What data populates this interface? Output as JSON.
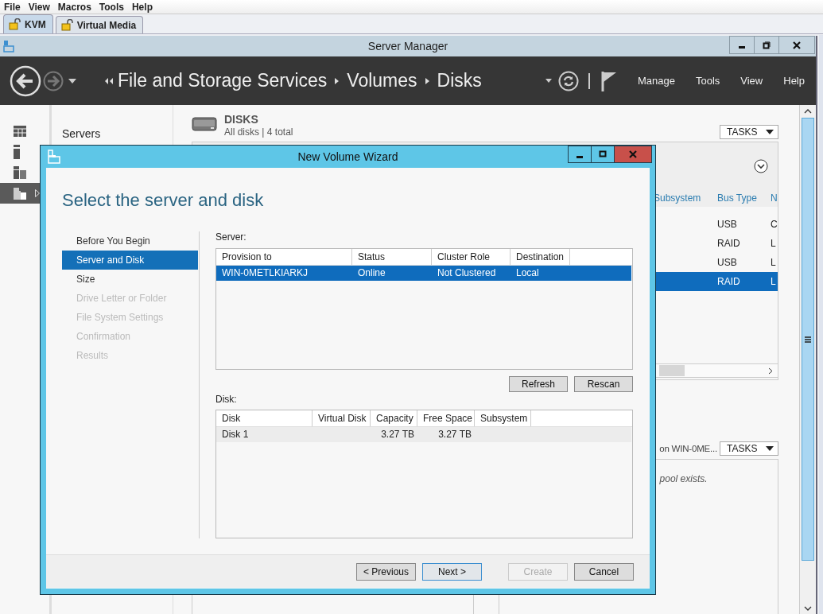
{
  "kvm_menu": [
    "File",
    "View",
    "Macros",
    "Tools",
    "Help"
  ],
  "kvm_tabs": [
    {
      "label": "KVM",
      "selected": true
    },
    {
      "label": "Virtual Media",
      "selected": false
    }
  ],
  "window": {
    "title": "Server Manager"
  },
  "header": {
    "breadcrumb": [
      "File and Storage Services",
      "Volumes",
      "Disks"
    ],
    "menu": [
      "Manage",
      "Tools",
      "View",
      "Help"
    ]
  },
  "sidebar": {
    "items": [
      {
        "selected": false
      },
      {
        "selected": false
      },
      {
        "selected": false
      },
      {
        "selected": true
      }
    ]
  },
  "nav": {
    "items": [
      "Servers"
    ]
  },
  "disks": {
    "title": "DISKS",
    "subtitle": "All disks | 4 total",
    "tasks": "TASKS",
    "columns": [
      "Subsystem",
      "Bus Type",
      "N"
    ],
    "rows": [
      {
        "bus_type": "USB",
        "column_3": "C",
        "selected": false
      },
      {
        "bus_type": "RAID",
        "column_3": "L",
        "selected": false
      },
      {
        "bus_type": "USB",
        "column_3": "L",
        "selected": false
      },
      {
        "bus_type": "RAID",
        "column_3": "L",
        "selected": true
      }
    ]
  },
  "storage_pools": {
    "title": "on WIN-0ME...",
    "tasks": "TASKS",
    "message": "pool exists."
  },
  "wizard": {
    "title": "New Volume Wizard",
    "heading": "Select the server and disk",
    "steps": [
      {
        "label": "Before You Begin",
        "selected": false,
        "disabled": false
      },
      {
        "label": "Server and Disk",
        "selected": true,
        "disabled": false
      },
      {
        "label": "Size",
        "selected": false,
        "disabled": false
      },
      {
        "label": "Drive Letter or Folder",
        "selected": false,
        "disabled": true
      },
      {
        "label": "File System Settings",
        "selected": false,
        "disabled": true
      },
      {
        "label": "Confirmation",
        "selected": false,
        "disabled": true
      },
      {
        "label": "Results",
        "selected": false,
        "disabled": true
      }
    ],
    "server_label": "Server:",
    "server_table": {
      "columns": [
        "Provision to",
        "Status",
        "Cluster Role",
        "Destination"
      ],
      "rows": [
        {
          "cells": [
            "WIN-0METLKIARKJ",
            "Online",
            "Not Clustered",
            "Local"
          ],
          "selected": true
        }
      ]
    },
    "server_buttons": [
      "Refresh",
      "Rescan"
    ],
    "disk_label": "Disk:",
    "disk_table": {
      "columns": [
        "Disk",
        "Virtual Disk",
        "Capacity",
        "Free Space",
        "Subsystem"
      ],
      "rows": [
        {
          "disk": "Disk 1",
          "capacity": "3.27 TB",
          "free_space": "3.27 TB"
        }
      ]
    },
    "buttons": [
      {
        "label": "< Previous",
        "default": false,
        "disabled": false
      },
      {
        "label": "Next >",
        "default": true,
        "disabled": false
      },
      {
        "label": "Create",
        "default": false,
        "disabled": true
      },
      {
        "label": "Cancel",
        "default": false,
        "disabled": false
      }
    ]
  }
}
